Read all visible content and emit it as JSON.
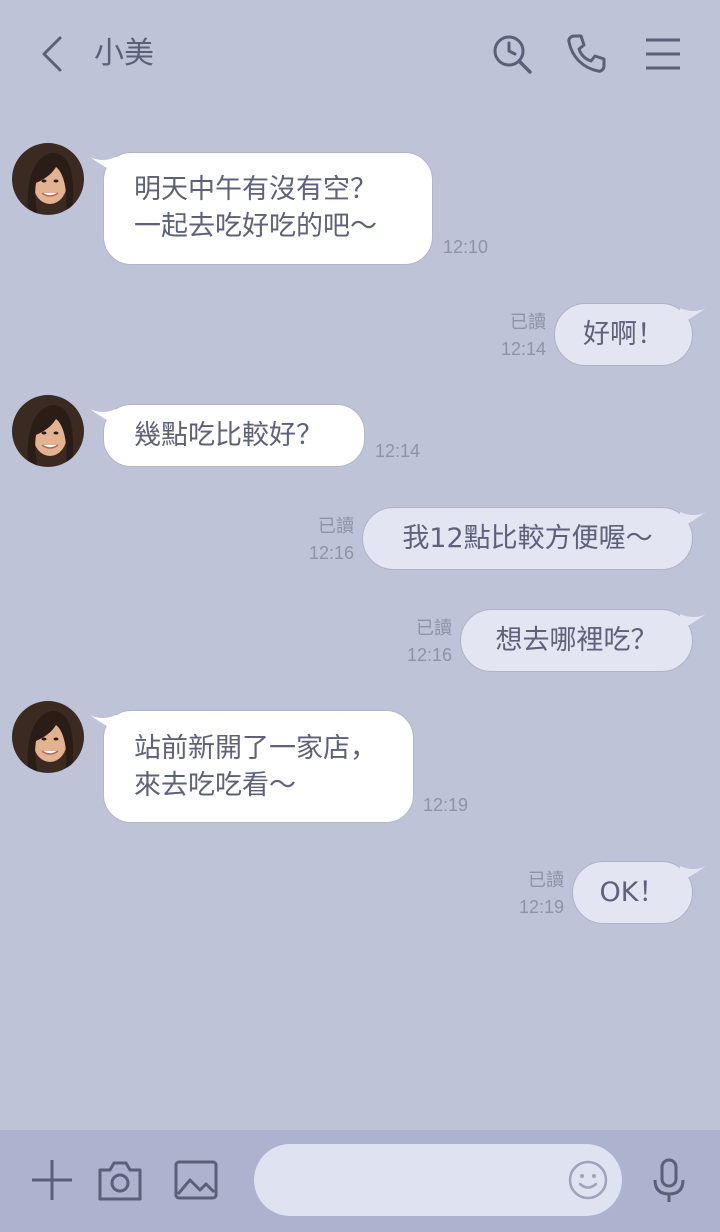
{
  "header": {
    "contact_name": "小美",
    "icons": [
      "back-icon",
      "search-icon",
      "phone-icon",
      "menu-icon"
    ]
  },
  "messages": [
    {
      "direction": "in",
      "lines": [
        "明天中午有沒有空？",
        "一起去吃好吃的吧～"
      ],
      "time": "12:10"
    },
    {
      "direction": "out",
      "lines": [
        "好啊！"
      ],
      "read": "已讀",
      "time": "12:14"
    },
    {
      "direction": "in",
      "lines": [
        "幾點吃比較好？"
      ],
      "time": "12:14"
    },
    {
      "direction": "out",
      "lines": [
        "我12點比較方便喔～"
      ],
      "read": "已讀",
      "time": "12:16"
    },
    {
      "direction": "out",
      "lines": [
        "想去哪裡吃？"
      ],
      "read": "已讀",
      "time": "12:16"
    },
    {
      "direction": "in",
      "lines": [
        "站前新開了一家店，",
        "來去吃吃看～"
      ],
      "time": "12:19"
    },
    {
      "direction": "out",
      "lines": [
        "OK！"
      ],
      "read": "已讀",
      "time": "12:19"
    }
  ],
  "composer": {
    "placeholder": "",
    "icons": [
      "plus-icon",
      "camera-icon",
      "image-icon",
      "emoji-icon",
      "microphone-icon"
    ]
  },
  "colors": {
    "background": "#bfc3d8",
    "incoming_bubble": "#ffffff",
    "outgoing_bubble": "#e3e5f2",
    "text": "#5e6178",
    "meta_text": "#8f93aa",
    "bottom_bar": "#adb2ce"
  }
}
